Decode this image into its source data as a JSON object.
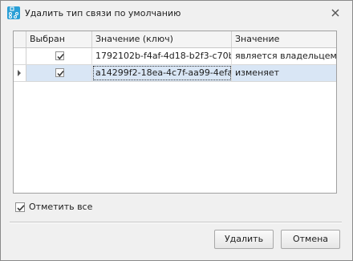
{
  "window": {
    "title": "Удалить тип связи по умолчанию",
    "app_icon": "app-logo-icon",
    "close_icon": "close-icon"
  },
  "grid": {
    "columns": [
      "Выбран",
      "Значение (ключ)",
      "Значение"
    ],
    "rows": [
      {
        "selected": true,
        "key": "1792102b-f4af-4d18-b2f3-c70b...",
        "value": "является владельцем",
        "current": false
      },
      {
        "selected": true,
        "key": "a14299f2-18ea-4c7f-aa99-4efa...",
        "value": "изменяет",
        "current": true
      }
    ]
  },
  "check_all": {
    "label": "Отметить все",
    "checked": true
  },
  "buttons": {
    "delete_label": "Удалить",
    "cancel_label": "Отмена"
  },
  "colors": {
    "accent": "#2a9fd6",
    "selection": "#d9e6f5"
  }
}
